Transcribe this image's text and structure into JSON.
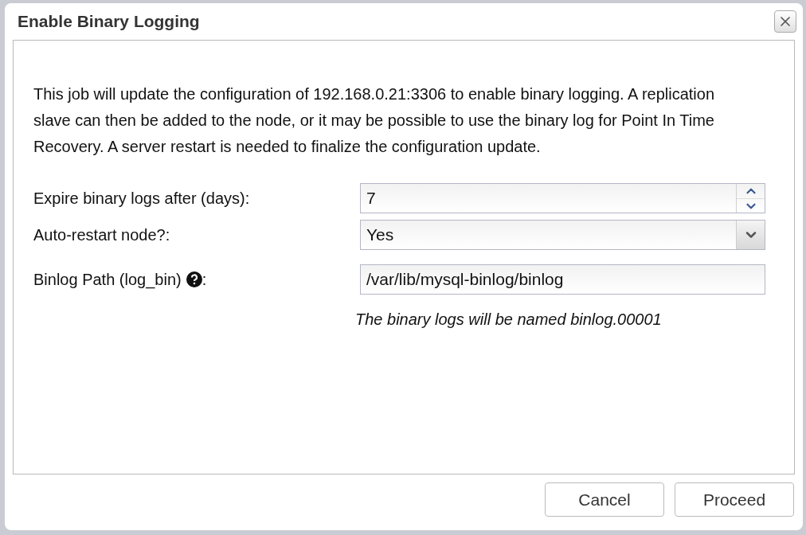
{
  "dialog": {
    "title": "Enable Binary Logging"
  },
  "description": "This job will update the configuration of 192.168.0.21:3306 to enable binary logging. A replication slave can then be added to the node, or it may be possible to use the binary log for Point In Time Recovery. A server restart is needed to finalize the configuration update.",
  "fields": [
    {
      "kind": "spinner",
      "label": "Expire binary logs after (days):",
      "value": "7"
    },
    {
      "kind": "select",
      "label": "Auto-restart node?:",
      "value": "Yes"
    },
    {
      "kind": "text",
      "label": "Binlog Path (log_bin)",
      "suffix": ":",
      "help": true,
      "value": "/var/lib/mysql-binlog/binlog",
      "hint": "The binary logs will be named binlog.00001"
    }
  ],
  "buttons": [
    "Cancel",
    "Proceed"
  ]
}
